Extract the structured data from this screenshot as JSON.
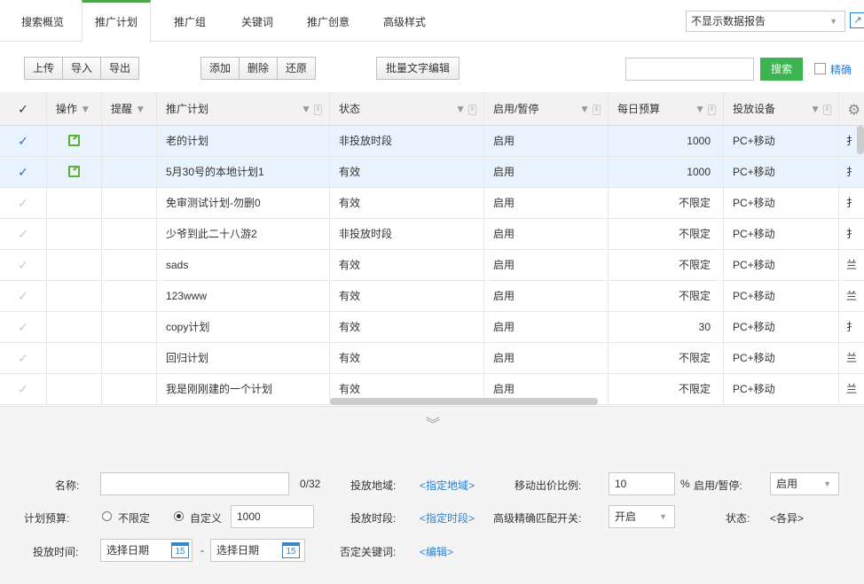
{
  "tabs": [
    "搜索概览",
    "推广计划",
    "推广组",
    "关键词",
    "推广创意",
    "高级样式"
  ],
  "report_select": "不显示数据报告",
  "toolbar": {
    "group1": [
      "上传",
      "导入",
      "导出"
    ],
    "group2": [
      "添加",
      "删除",
      "还原"
    ],
    "batch_edit": "批量文字编辑",
    "search_label": "搜索",
    "exact_label": "精确"
  },
  "table": {
    "headers": [
      "操作",
      "提醒",
      "推广计划",
      "状态",
      "启用/暂停",
      "每日预算",
      "投放设备"
    ],
    "rows": [
      {
        "selected": true,
        "edit": true,
        "plan": "老的计划",
        "status": "非投放时段",
        "enabled": "启用",
        "budget": "1000",
        "device": "PC+移动",
        "extra": "扌"
      },
      {
        "selected": true,
        "edit": true,
        "plan": "5月30号的本地计划1",
        "status": "有效",
        "enabled": "启用",
        "budget": "1000",
        "device": "PC+移动",
        "extra": "扌"
      },
      {
        "selected": false,
        "edit": false,
        "plan": "免审测试计划-勿删0",
        "status": "有效",
        "enabled": "启用",
        "budget": "不限定",
        "device": "PC+移动",
        "extra": "扌"
      },
      {
        "selected": false,
        "edit": false,
        "plan": "少爷到此二十八游2",
        "status": "非投放时段",
        "enabled": "启用",
        "budget": "不限定",
        "device": "PC+移动",
        "extra": "扌"
      },
      {
        "selected": false,
        "edit": false,
        "plan": "sads",
        "status": "有效",
        "enabled": "启用",
        "budget": "不限定",
        "device": "PC+移动",
        "extra": "兰"
      },
      {
        "selected": false,
        "edit": false,
        "plan": "123www",
        "status": "有效",
        "enabled": "启用",
        "budget": "不限定",
        "device": "PC+移动",
        "extra": "兰"
      },
      {
        "selected": false,
        "edit": false,
        "plan": "copy计划",
        "status": "有效",
        "enabled": "启用",
        "budget": "30",
        "device": "PC+移动",
        "extra": "扌"
      },
      {
        "selected": false,
        "edit": false,
        "plan": "回归计划",
        "status": "有效",
        "enabled": "启用",
        "budget": "不限定",
        "device": "PC+移动",
        "extra": "兰"
      },
      {
        "selected": false,
        "edit": false,
        "plan": "我是刚刚建的一个计划",
        "status": "有效",
        "enabled": "启用",
        "budget": "不限定",
        "device": "PC+移动",
        "extra": "兰"
      }
    ]
  },
  "form": {
    "name_label": "名称:",
    "name_counter": "0/32",
    "region_label": "投放地域:",
    "region_link": "<指定地域>",
    "mobile_ratio_label": "移动出价比例:",
    "mobile_ratio_value": "10",
    "percent": "%",
    "enable_label": "启用/暂停:",
    "enable_value": "启用",
    "budget_label": "计划预算:",
    "budget_opt1": "不限定",
    "budget_opt2": "自定义",
    "budget_value": "1000",
    "time_label": "投放时段:",
    "time_link": "<指定时段>",
    "advanced_label": "高级精确匹配开关:",
    "advanced_value": "开启",
    "state_label": "状态:",
    "state_value": "<各异>",
    "date_label": "投放时间:",
    "date_start": "选择日期",
    "date_sep": "-",
    "date_end": "选择日期",
    "cal_day": "15",
    "neg_kw_label": "否定关键词:",
    "neg_kw_link": "<编辑>"
  }
}
